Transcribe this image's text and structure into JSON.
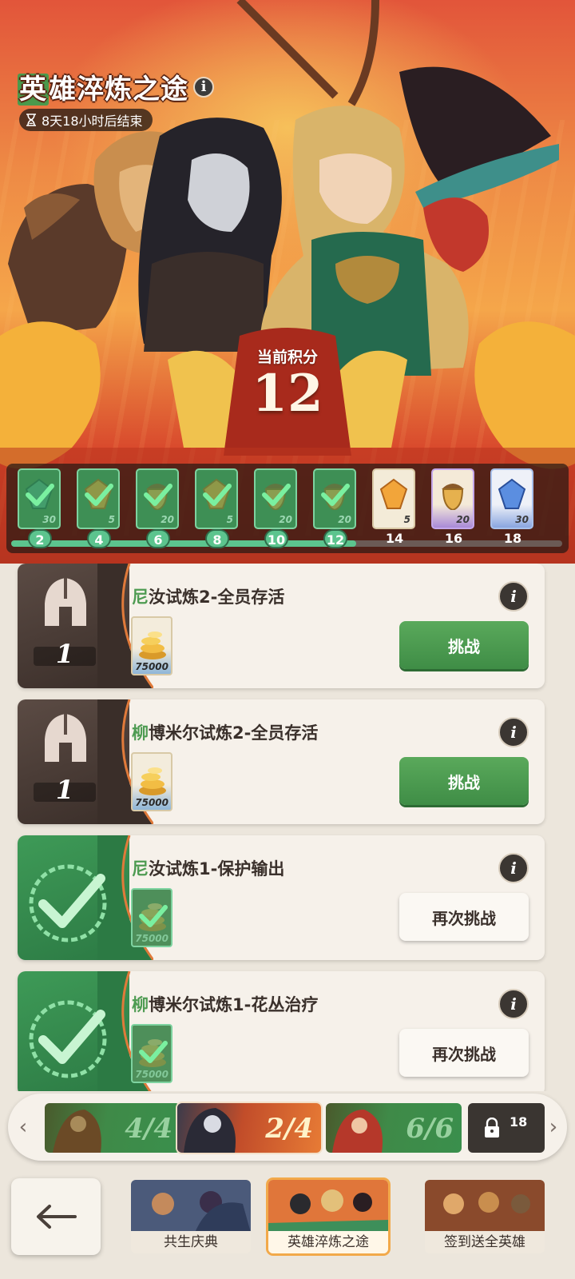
{
  "event": {
    "title_first_char": "英",
    "title_rest": "雄淬炼之途",
    "info_icon_label": "i",
    "timer_text": "8天18小时后结束",
    "score_label": "当前积分",
    "score_value": "12"
  },
  "milestones": {
    "current_score": 12,
    "items": [
      {
        "points": "2",
        "quantity": "30",
        "reward": "emerald-shard",
        "claimed": true
      },
      {
        "points": "4",
        "quantity": "5",
        "reward": "amber-shard",
        "claimed": true
      },
      {
        "points": "6",
        "quantity": "20",
        "reward": "acorn",
        "claimed": true
      },
      {
        "points": "8",
        "quantity": "5",
        "reward": "amber-shard",
        "claimed": true
      },
      {
        "points": "10",
        "quantity": "20",
        "reward": "acorn",
        "claimed": true
      },
      {
        "points": "12",
        "quantity": "20",
        "reward": "acorn",
        "claimed": true
      },
      {
        "points": "14",
        "quantity": "5",
        "reward": "amber-shard",
        "claimed": false
      },
      {
        "points": "16",
        "quantity": "20",
        "reward": "acorn",
        "claimed": false
      },
      {
        "points": "18",
        "quantity": "30",
        "reward": "sapphire-shard",
        "claimed": false
      }
    ]
  },
  "tasks": [
    {
      "title_first": "尼",
      "title_rest": "汝试炼2-全员存活",
      "count": "1",
      "reward_amount": "75000",
      "completed": false,
      "button": "挑战",
      "info_label": "i"
    },
    {
      "title_first": "柳",
      "title_rest": "博米尔试炼2-全员存活",
      "count": "1",
      "reward_amount": "75000",
      "completed": false,
      "button": "挑战",
      "info_label": "i"
    },
    {
      "title_first": "尼",
      "title_rest": "汝试炼1-保护输出",
      "reward_amount": "75000",
      "completed": true,
      "button": "再次挑战",
      "info_label": "i"
    },
    {
      "title_first": "柳",
      "title_rest": "博米尔试炼1-花丛治疗",
      "reward_amount": "75000",
      "completed": true,
      "button": "再次挑战",
      "info_label": "i"
    }
  ],
  "stages": [
    {
      "progress": "4/4",
      "state": "complete"
    },
    {
      "progress": "2/4",
      "state": "active"
    },
    {
      "progress": "6/6",
      "state": "complete"
    },
    {
      "progress": "18",
      "state": "locked"
    }
  ],
  "nav": {
    "tabs": [
      {
        "label": "共生庆典",
        "selected": false
      },
      {
        "label": "英雄淬炼之途",
        "selected": true
      },
      {
        "label": "签到送全英雄",
        "selected": false
      }
    ]
  },
  "colors": {
    "accent_green": "#4e9b52",
    "progress_green": "#5cc48e",
    "active_tab_border": "#f2a94a"
  }
}
